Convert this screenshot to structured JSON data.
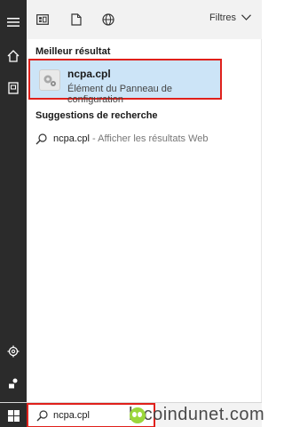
{
  "topbar": {
    "filters_label": "Filtres",
    "icons": [
      "apps-grid-icon",
      "document-icon",
      "globe-icon"
    ]
  },
  "rail": {
    "icons": [
      "hamburger-icon",
      "home-icon",
      "device-icon",
      "gear-icon",
      "account-icon",
      "windows-start-icon"
    ]
  },
  "best_match": {
    "section_title": "Meilleur résultat",
    "title": "ncpa.cpl",
    "subtitle": "Élément du Panneau de configuration"
  },
  "suggestions": {
    "section_title": "Suggestions de recherche",
    "items": [
      {
        "query": "ncpa.cpl",
        "hint": "Afficher les résultats Web"
      }
    ]
  },
  "taskbar": {
    "search_value": "ncpa.cpl",
    "watermark": "lecoindunet.com"
  },
  "colors": {
    "rail": "#2b2b2b",
    "highlight_fill": "#cce4f7",
    "highlight_border": "#e0201b",
    "watermark_logo": "#9bd63b"
  }
}
